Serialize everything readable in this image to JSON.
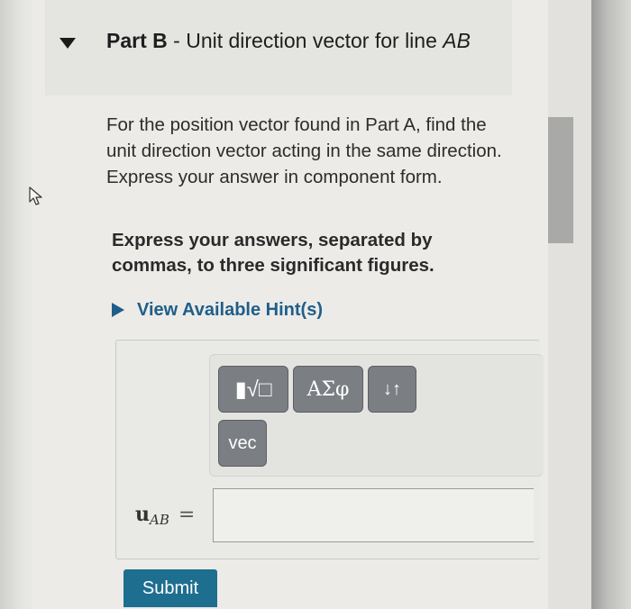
{
  "part": {
    "label": "Part B",
    "separator": " - ",
    "title_text": "Unit direction vector for line ",
    "title_var": "AB"
  },
  "prompt": "For the position vector found in Part A, find the unit direction vector acting in the same direction. Express your answer in component form.",
  "instructions": "Express your answers, separated by commas, to three significant figures.",
  "hint": {
    "label": "View Available Hint(s)"
  },
  "toolbar": {
    "templates_icon": "templates-icon",
    "templates_glyph": "▮√□",
    "symbols_label": "ΑΣφ",
    "arrows_glyph": "↓↑",
    "vec_label": "vec"
  },
  "answer": {
    "variable": "u",
    "subscript": "AB",
    "equals": "=",
    "value": ""
  },
  "submit_label": "Submit",
  "colors": {
    "accent": "#1e6e90",
    "link": "#1f5e8a",
    "tool_button": "#7b7e82"
  }
}
